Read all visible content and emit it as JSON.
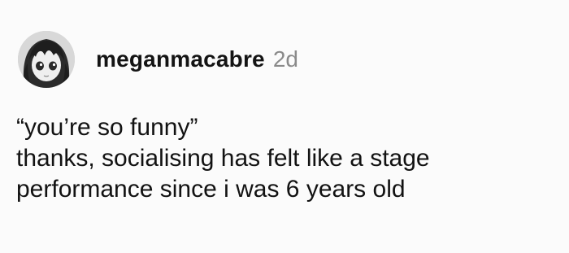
{
  "post": {
    "author": {
      "username": "meganmacabre",
      "avatar": "anime-girl-avatar-icon"
    },
    "timestamp": "2d",
    "quote": "“you’re so funny”",
    "reply_lines": [
      "thanks, socialising has felt like a stage",
      "performance since i was 6 years old"
    ]
  },
  "colors": {
    "background": "#fbfbfb",
    "text": "#121212",
    "timestamp": "#8a8a8a"
  }
}
